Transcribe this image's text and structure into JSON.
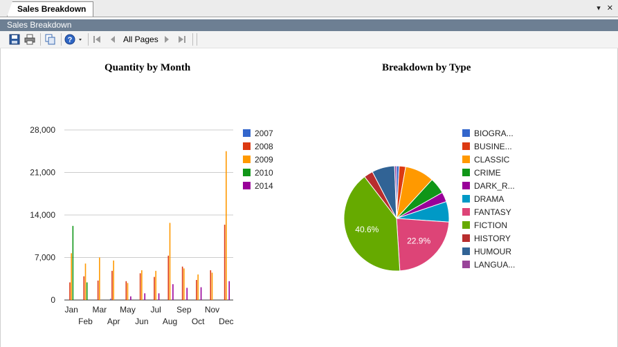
{
  "tab": {
    "label": "Sales Breakdown",
    "controls": "▾ ✕"
  },
  "titlebar": {
    "label": "Sales Breakdown"
  },
  "toolbar": {
    "page_selector": "All Pages",
    "icons": [
      "save-icon",
      "print-icon",
      "copy-icon",
      "help-icon",
      "first-page-icon",
      "prev-page-icon",
      "next-page-icon",
      "last-page-icon"
    ]
  },
  "charts": {
    "bar_title": "Quantity by Month",
    "pie_title": "Breakdown by Type"
  },
  "chart_data": [
    {
      "type": "bar",
      "title": "Quantity by Month",
      "xlabel": "",
      "ylabel": "",
      "ylim": [
        0,
        28000
      ],
      "yticks": [
        "0",
        "7,000",
        "14,000",
        "21,000",
        "28,000"
      ],
      "categories": [
        "Jan",
        "Feb",
        "Mar",
        "Apr",
        "May",
        "Jun",
        "Jul",
        "Aug",
        "Sep",
        "Oct",
        "Nov",
        "Dec"
      ],
      "grid": true,
      "legend": "right",
      "series": [
        {
          "name": "2007",
          "color": "#3366cc",
          "values": [
            0,
            0,
            0,
            200,
            0,
            0,
            0,
            0,
            0,
            0,
            0,
            0
          ]
        },
        {
          "name": "2008",
          "color": "#dc3912",
          "values": [
            2900,
            3900,
            3200,
            4800,
            3100,
            4400,
            3800,
            7300,
            5500,
            3300,
            4900,
            12400
          ]
        },
        {
          "name": "2009",
          "color": "#ff9900",
          "values": [
            7700,
            6000,
            7000,
            6500,
            2800,
            4900,
            4800,
            12700,
            5200,
            4200,
            4500,
            24500
          ]
        },
        {
          "name": "2010",
          "color": "#109618",
          "values": [
            12200,
            2900,
            0,
            0,
            0,
            0,
            0,
            0,
            0,
            0,
            0,
            0
          ]
        },
        {
          "name": "2014",
          "color": "#990099",
          "values": [
            0,
            0,
            0,
            0,
            600,
            1100,
            1100,
            2600,
            2000,
            2100,
            0,
            3100
          ]
        }
      ]
    },
    {
      "type": "pie",
      "title": "Breakdown by Type",
      "legend": "right",
      "slices": [
        {
          "label": "BIOGRA...",
          "value": 0.8,
          "color": "#3366cc"
        },
        {
          "label": "BUSINE...",
          "value": 2.0,
          "color": "#dc3912"
        },
        {
          "label": "CLASSIC",
          "value": 9.0,
          "color": "#ff9900"
        },
        {
          "label": "CRIME",
          "value": 5.0,
          "color": "#109618"
        },
        {
          "label": "DARK_R...",
          "value": 3.0,
          "color": "#990099"
        },
        {
          "label": "DRAMA",
          "value": 6.3,
          "color": "#0099c6"
        },
        {
          "label": "FANTASY",
          "value": 22.9,
          "color": "#dd4477",
          "display": "22.9%"
        },
        {
          "label": "FICTION",
          "value": 40.6,
          "color": "#66aa00",
          "display": "40.6%"
        },
        {
          "label": "HISTORY",
          "value": 2.8,
          "color": "#b82e2e"
        },
        {
          "label": "HUMOUR",
          "value": 7.0,
          "color": "#316395"
        },
        {
          "label": "LANGUA...",
          "value": 0.6,
          "color": "#994499"
        }
      ]
    }
  ]
}
